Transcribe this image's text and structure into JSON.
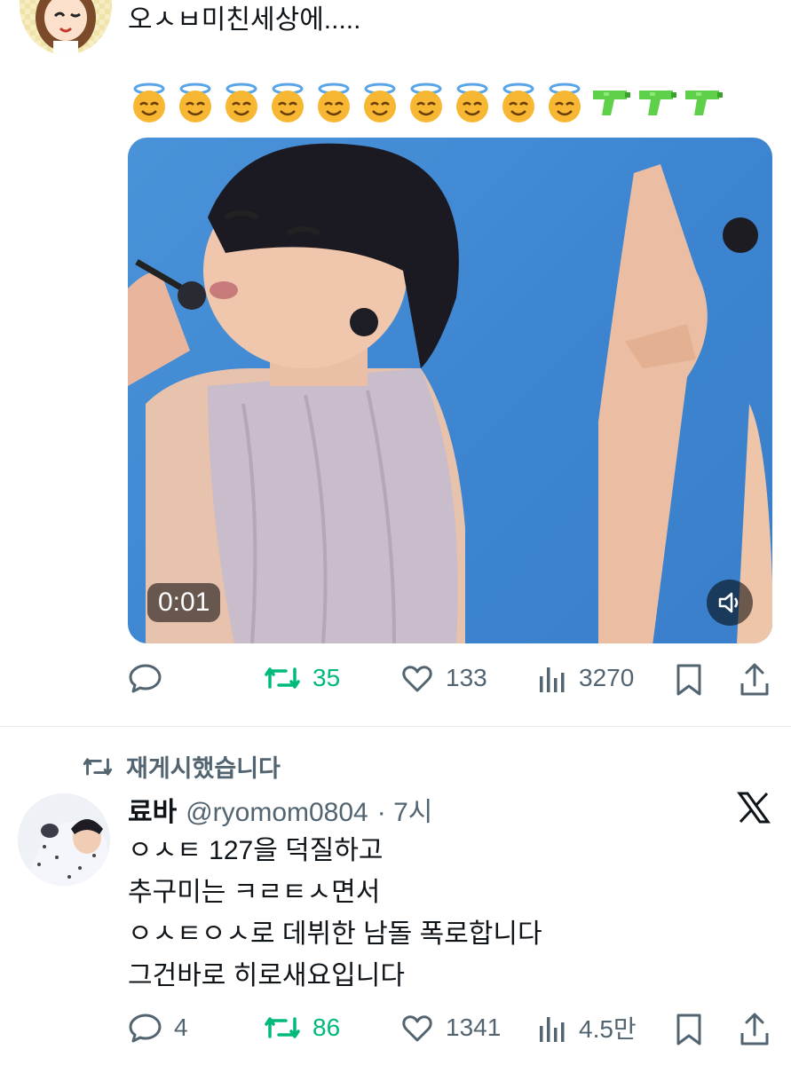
{
  "tweet1": {
    "text_line1": "오ㅅㅂ미친세상에.....",
    "emoji_line": [
      "halo",
      "halo",
      "halo",
      "halo",
      "halo",
      "halo",
      "halo",
      "halo",
      "halo",
      "halo",
      "water-pistol",
      "water-pistol",
      "water-pistol"
    ],
    "video_time": "0:01",
    "reply_count": "",
    "retweet_count": "35",
    "like_count": "133",
    "view_count": "3270"
  },
  "retweet_label": "재게시했습니다",
  "tweet2": {
    "display_name": "료바",
    "handle": "@ryomom0804",
    "time": "· 7시",
    "lines": [
      "ㅇㅅㅌ 127을 덕질하고",
      "추구미는 ㅋㄹㅌㅅ면서",
      "ㅇㅅㅌㅇㅅ로 데뷔한 남돌 폭로합니다",
      "그건바로 히로새요입니다"
    ],
    "reply_count": "4",
    "retweet_count": "86",
    "like_count": "1341",
    "view_count": "4.5만"
  },
  "colors": {
    "retweet": "#00ba7c",
    "muted": "#536471",
    "text": "#0f1419"
  }
}
